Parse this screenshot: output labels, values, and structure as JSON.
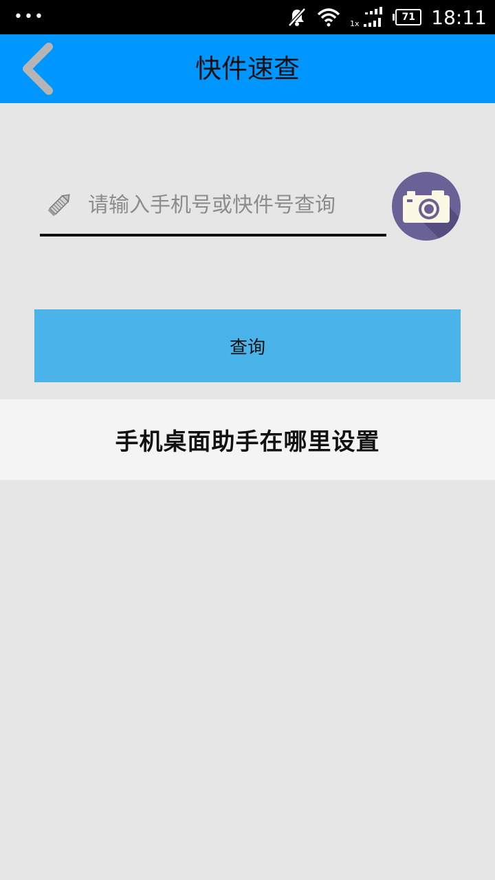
{
  "status_bar": {
    "menu_dots": "•••",
    "battery_level": "71",
    "network_label": "1x",
    "time": "18:11",
    "icons": [
      "notification-muted-icon",
      "wifi-icon",
      "cellular-signal-icon",
      "battery-icon"
    ]
  },
  "app_bar": {
    "title": "快件速查",
    "back_icon": "chevron-left-icon",
    "background_color": "#0096ff"
  },
  "search": {
    "placeholder": "请输入手机号或快件号查询",
    "value": "",
    "leading_icon": "pencil-icon",
    "camera_icon": "camera-icon"
  },
  "query_button": {
    "label": "查询",
    "color": "#4ab3ea"
  },
  "help_link": {
    "text": "手机桌面助手在哪里设置"
  }
}
